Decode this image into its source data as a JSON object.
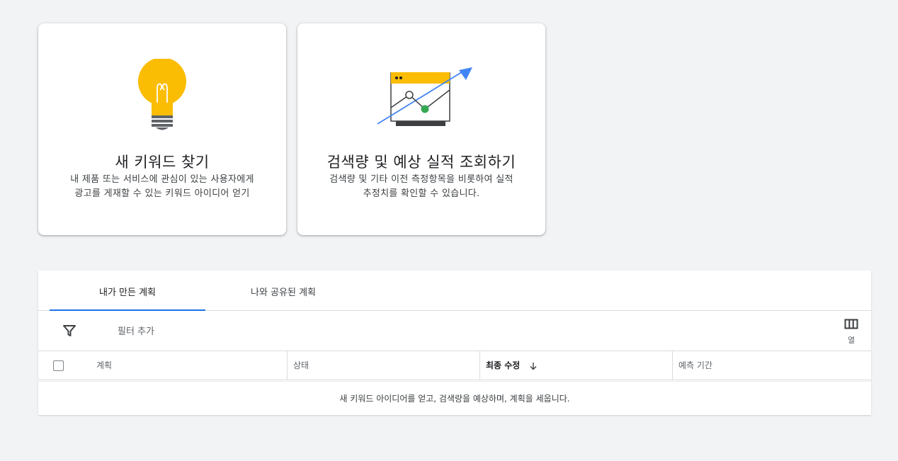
{
  "cards": [
    {
      "title": "새 키워드 찾기",
      "description_line1": "내 제품 또는 서비스에 관심이 있는 사용자에게",
      "description_line2": "광고를 게재할 수 있는 키워드 아이디어 얻기",
      "icon": "lightbulb-icon"
    },
    {
      "title": "검색량 및 예상 실적 조회하기",
      "description_line1": "검색량 및 기타 이전 측정항목을 비롯하여 실적",
      "description_line2": "추정치를 확인할 수 있습니다.",
      "icon": "trend-chart-icon"
    }
  ],
  "tabs": {
    "mine": "내가 만든 계획",
    "shared": "나와 공유된 계획",
    "selected": "mine"
  },
  "toolbar": {
    "filter_icon": "filter-icon",
    "add_filter": "필터 추가",
    "columns_icon": "columns-icon",
    "columns_label": "열"
  },
  "table": {
    "headers": {
      "plan": "계획",
      "status": "상태",
      "last_modified": "최종 수정",
      "forecast_period": "예측 기간"
    },
    "sort": "descending",
    "empty_message": "새 키워드 아이디어를 얻고, 검색량을 예상하며, 계획을 세웁니다."
  },
  "colors": {
    "accent": "#1a73e8",
    "bulb": "#fbbc04",
    "green": "#34a853",
    "background": "#f1f3f4"
  }
}
